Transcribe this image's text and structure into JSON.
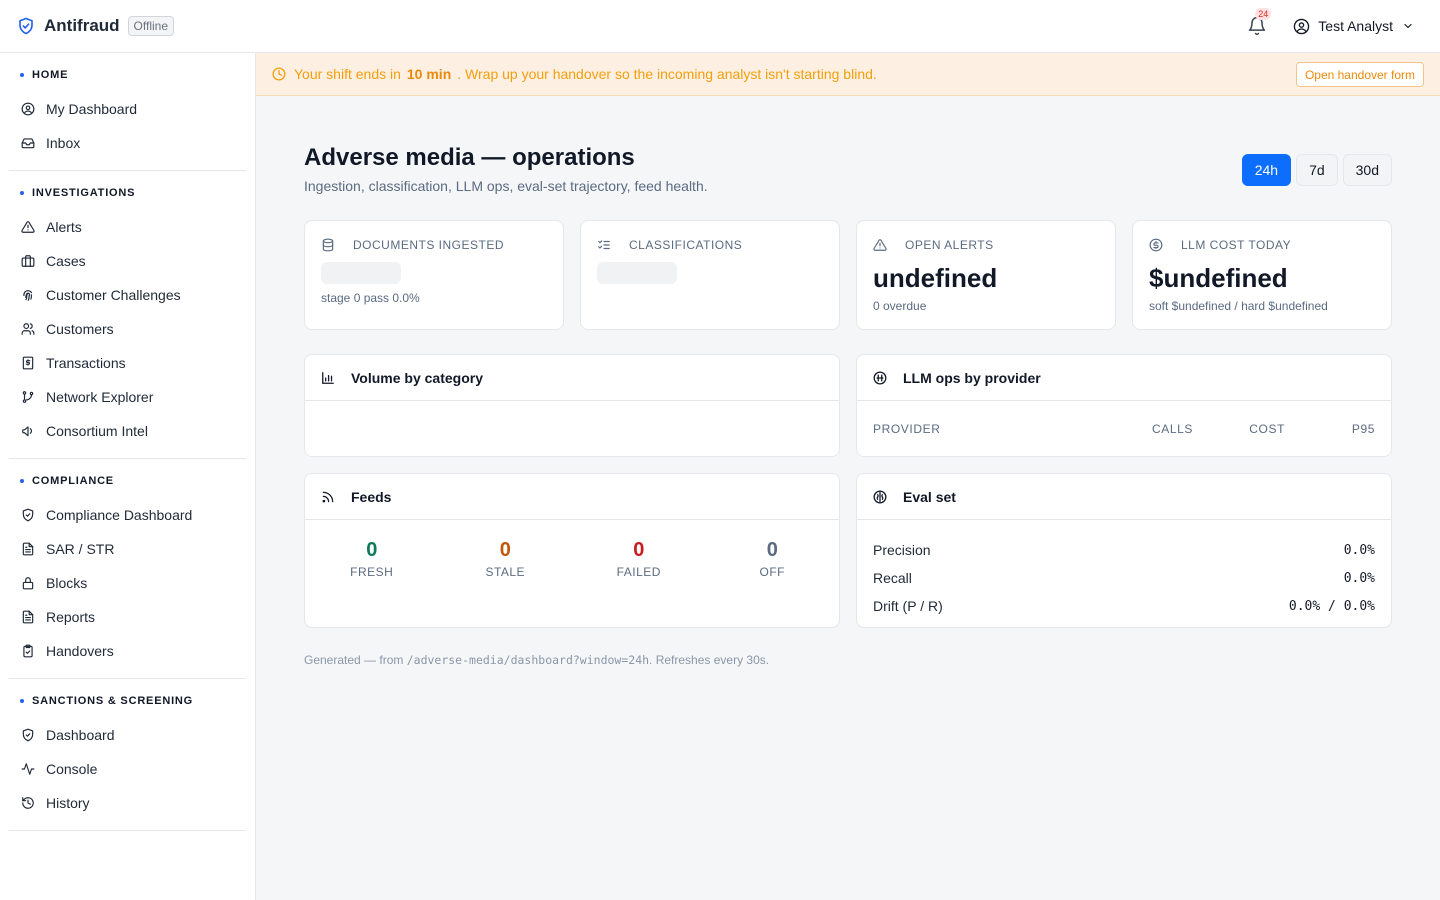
{
  "topbar": {
    "brand": "Antifraud",
    "status_badge": "Offline",
    "notification_count": "24",
    "user_name": "Test Analyst"
  },
  "sidebar": {
    "sections": [
      {
        "heading": "HOME",
        "items": [
          {
            "label": "My Dashboard",
            "icon": "user-circle-icon"
          },
          {
            "label": "Inbox",
            "icon": "inbox-icon"
          }
        ]
      },
      {
        "heading": "INVESTIGATIONS",
        "items": [
          {
            "label": "Alerts",
            "icon": "warning-triangle-icon"
          },
          {
            "label": "Cases",
            "icon": "briefcase-icon"
          },
          {
            "label": "Customer Challenges",
            "icon": "fingerprint-icon"
          },
          {
            "label": "Customers",
            "icon": "users-icon"
          },
          {
            "label": "Transactions",
            "icon": "receipt-dollar-icon"
          },
          {
            "label": "Network Explorer",
            "icon": "git-branch-icon"
          },
          {
            "label": "Consortium Intel",
            "icon": "megaphone-icon"
          }
        ]
      },
      {
        "heading": "COMPLIANCE",
        "items": [
          {
            "label": "Compliance Dashboard",
            "icon": "shield-check-icon"
          },
          {
            "label": "SAR / STR",
            "icon": "document-icon"
          },
          {
            "label": "Blocks",
            "icon": "lock-icon"
          },
          {
            "label": "Reports",
            "icon": "document-icon"
          },
          {
            "label": "Handovers",
            "icon": "clipboard-check-icon"
          }
        ]
      },
      {
        "heading": "SANCTIONS & SCREENING",
        "items": [
          {
            "label": "Dashboard",
            "icon": "shield-check-icon"
          },
          {
            "label": "Console",
            "icon": "activity-icon"
          },
          {
            "label": "History",
            "icon": "history-icon"
          }
        ]
      }
    ]
  },
  "banner": {
    "prefix": "Your shift ends in",
    "time": "10 min",
    "suffix": ". Wrap up your handover so the incoming analyst isn't starting blind.",
    "button": "Open handover form"
  },
  "page": {
    "title": "Adverse media — operations",
    "subtitle": "Ingestion, classification, LLM ops, eval-set trajectory, feed health.",
    "ranges": [
      "24h",
      "7d",
      "30d"
    ],
    "active_range": "24h"
  },
  "kpis": {
    "documents": {
      "label": "DOCUMENTS INGESTED",
      "sub": "stage 0 pass 0.0%"
    },
    "classifications": {
      "label": "CLASSIFICATIONS"
    },
    "alerts": {
      "label": "OPEN ALERTS",
      "value": "undefined",
      "sub": "0 overdue"
    },
    "llm_cost": {
      "label": "LLM COST TODAY",
      "value": "$undefined",
      "sub": "soft $undefined / hard $undefined"
    }
  },
  "volume": {
    "title": "Volume by category"
  },
  "llm_ops": {
    "title": "LLM ops by provider",
    "columns": [
      "PROVIDER",
      "CALLS",
      "COST",
      "P95"
    ]
  },
  "feeds": {
    "title": "Feeds",
    "stats": [
      {
        "value": "0",
        "label": "FRESH",
        "color": "#0f7a5a"
      },
      {
        "value": "0",
        "label": "STALE",
        "color": "#c2570c"
      },
      {
        "value": "0",
        "label": "FAILED",
        "color": "#c81e1e"
      },
      {
        "value": "0",
        "label": "OFF",
        "color": "#5b6b82"
      }
    ]
  },
  "eval_set": {
    "title": "Eval set",
    "rows": [
      {
        "label": "Precision",
        "value": "0.0%"
      },
      {
        "label": "Recall",
        "value": "0.0%"
      },
      {
        "label": "Drift (P / R)",
        "value": "0.0% / 0.0%"
      }
    ]
  },
  "footer": {
    "prefix": "Generated — from",
    "path": "/adverse-media/dashboard?window=24h",
    "suffix": ". Refreshes every 30s."
  }
}
